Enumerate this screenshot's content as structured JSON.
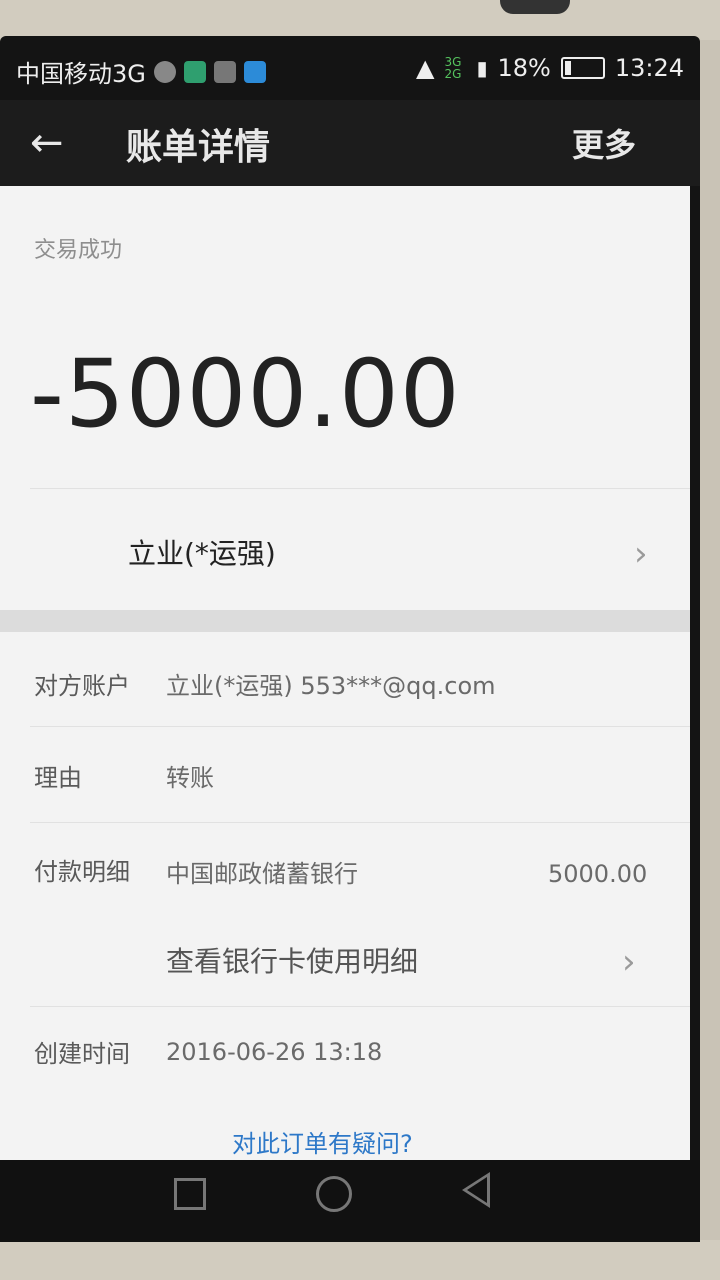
{
  "status_bar": {
    "carrier": "中国移动3G",
    "network_badge": "3G 2G",
    "battery": "18%",
    "battery_level": 0.18,
    "time": "13:24",
    "icons": [
      "sync-icon",
      "app-icon",
      "gallery-icon",
      "video-icon",
      "wifi-icon",
      "signal-icon",
      "battery-icon"
    ]
  },
  "header": {
    "back_icon": "←",
    "title": "账单详情",
    "more": "更多"
  },
  "summary": {
    "status": "交易成功",
    "amount": "-5000.00",
    "payee": "立业(*运强)"
  },
  "details": [
    {
      "label": "对方账户",
      "value": "立业(*运强) 553***@qq.com"
    },
    {
      "label": "理由",
      "value": "转账"
    },
    {
      "label": "付款明细",
      "value": "中国邮政储蓄银行",
      "amount": "5000.00"
    },
    {
      "label": "",
      "value": "查看银行卡使用明细"
    },
    {
      "label": "创建时间",
      "value": "2016-06-26 13:18"
    }
  ],
  "footer": {
    "question": "对此订单有疑问?"
  },
  "colors": {
    "link": "#2d78c8",
    "appbar": "#1c1c1c",
    "page": "#f3f3f3"
  }
}
